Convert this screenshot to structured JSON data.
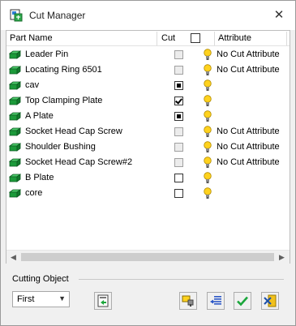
{
  "window": {
    "title": "Cut Manager"
  },
  "list": {
    "columns": {
      "part_name": "Part Name",
      "cut": "Cut",
      "attribute": "Attribute"
    },
    "rows": [
      {
        "name": "Leader Pin",
        "cut": "disabled",
        "attribute": "No Cut Attribute"
      },
      {
        "name": "Locating Ring 6501",
        "cut": "disabled",
        "attribute": "No Cut Attribute"
      },
      {
        "name": "cav",
        "cut": "indeterminate",
        "attribute": ""
      },
      {
        "name": "Top Clamping Plate",
        "cut": "checked",
        "attribute": ""
      },
      {
        "name": "A Plate",
        "cut": "indeterminate",
        "attribute": ""
      },
      {
        "name": "Socket Head Cap Screw",
        "cut": "disabled",
        "attribute": "No Cut Attribute"
      },
      {
        "name": "Shoulder Bushing",
        "cut": "disabled",
        "attribute": "No Cut Attribute"
      },
      {
        "name": "Socket Head Cap Screw#2",
        "cut": "disabled",
        "attribute": "No Cut Attribute"
      },
      {
        "name": "B Plate",
        "cut": "unchecked",
        "attribute": ""
      },
      {
        "name": "core",
        "cut": "unchecked",
        "attribute": ""
      }
    ]
  },
  "cutting_object": {
    "label": "Cutting Object",
    "selected": "First"
  },
  "icons": {
    "part": "solid-part-icon",
    "attribute": "lightbulb-icon",
    "buttons": [
      "add-object-icon",
      "attribute-light-icon",
      "list-swap-icon",
      "ok-check-icon",
      "cancel-icon"
    ]
  },
  "colors": {
    "part_green": "#1c9a3a",
    "bulb_yellow": "#ffd21e",
    "ok_green": "#1aa63b",
    "cancel_yellow": "#f2c11c"
  }
}
